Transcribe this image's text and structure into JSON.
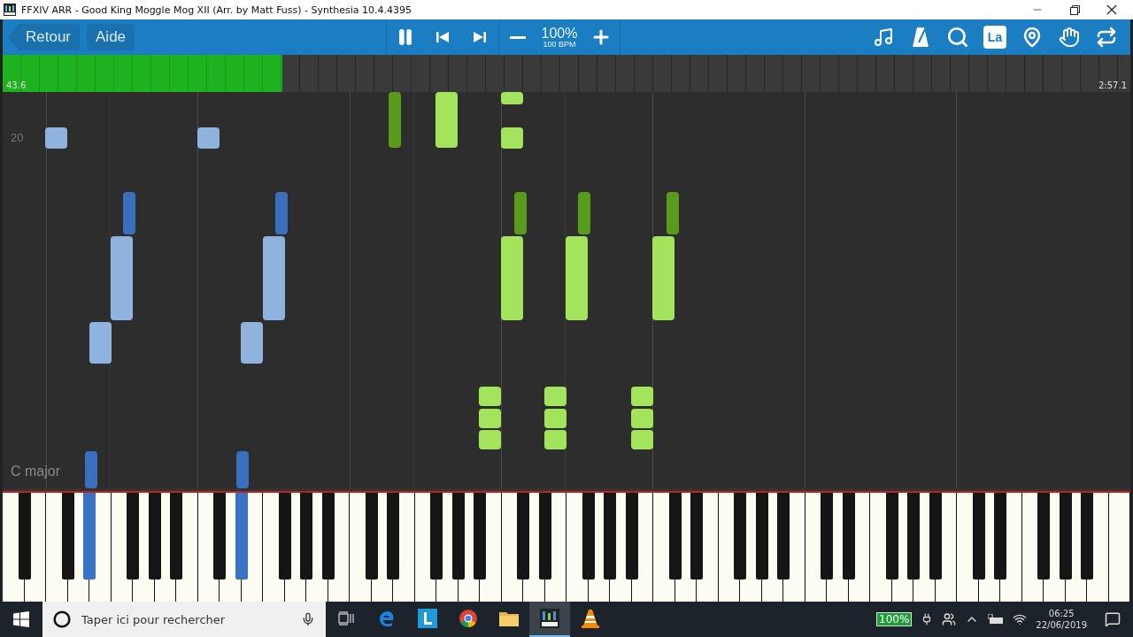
{
  "window": {
    "title": "FFXIV ARR - Good King Moggle Mog XII (Arr. by Matt Fuss) - Synthesia 10.4.4395"
  },
  "toolbar": {
    "back": "Retour",
    "help": "Aide",
    "speed": "100%",
    "bpm": "100 BPM",
    "key_label": "La"
  },
  "progress": {
    "level": 0.248,
    "elapsed": "43.6",
    "total": "2:57.1"
  },
  "staff": {
    "measure_label": "20",
    "key": "C major"
  },
  "taskbar": {
    "search": {
      "placeholder": "Taper ici pour rechercher"
    },
    "apps": [
      {
        "kind": "edge",
        "selected": false
      },
      {
        "kind": "launcher",
        "selected": false
      },
      {
        "kind": "chrome",
        "selected": false
      },
      {
        "kind": "folder",
        "selected": false
      },
      {
        "kind": "synthesia",
        "selected": true
      },
      {
        "kind": "vlc",
        "selected": false
      }
    ],
    "battery": "100%",
    "time": "06:25",
    "date": "22/06/2019"
  }
}
